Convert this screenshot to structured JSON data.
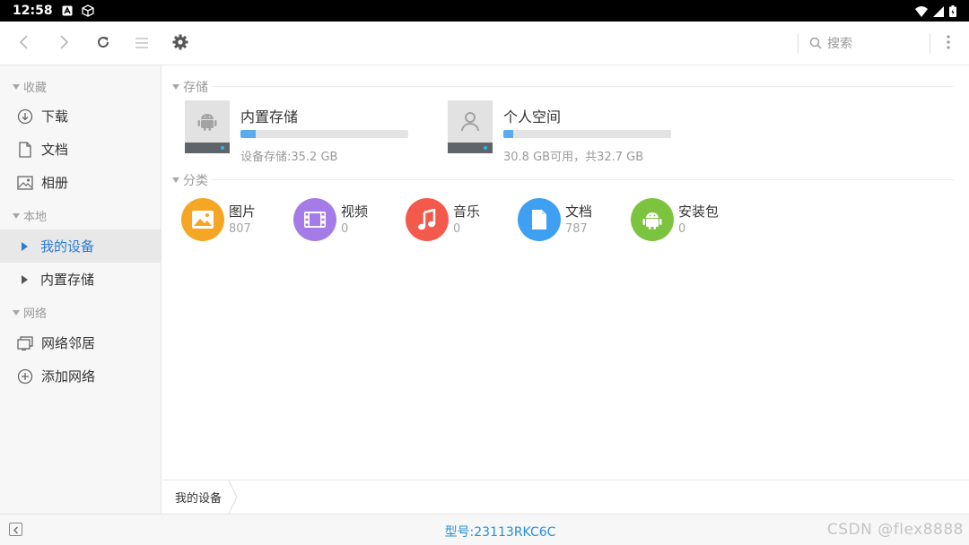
{
  "status_bar": {
    "time": "12:58"
  },
  "toolbar": {
    "search_placeholder": "搜索"
  },
  "sidebar": {
    "sections": [
      {
        "title": "收藏"
      },
      {
        "title": "本地"
      },
      {
        "title": "网络"
      }
    ],
    "items": [
      {
        "label": "下载"
      },
      {
        "label": "文档"
      },
      {
        "label": "相册"
      },
      {
        "label": "我的设备"
      },
      {
        "label": "内置存储"
      },
      {
        "label": "网络邻居"
      },
      {
        "label": "添加网络"
      }
    ]
  },
  "main": {
    "storage_header": "存储",
    "storage": [
      {
        "name": "内置存储",
        "info": "设备存储:35.2 GB",
        "used_fraction": 0.09
      },
      {
        "name": "个人空间",
        "info": "30.8 GB可用，共32.7 GB",
        "used_fraction": 0.06
      }
    ],
    "category_header": "分类",
    "categories": [
      {
        "name": "图片",
        "count": "807",
        "color": "#f5a623",
        "icon": "image-icon"
      },
      {
        "name": "视频",
        "count": "0",
        "color": "#a57be8",
        "icon": "film-icon"
      },
      {
        "name": "音乐",
        "count": "0",
        "color": "#f45a4c",
        "icon": "music-note-icon"
      },
      {
        "name": "文档",
        "count": "787",
        "color": "#3f9ff0",
        "icon": "document-icon"
      },
      {
        "name": "安装包",
        "count": "0",
        "color": "#7cc440",
        "icon": "android-icon"
      }
    ]
  },
  "breadcrumb": {
    "current": "我的设备"
  },
  "bottom_bar": {
    "model": "型号:23113RKC6C",
    "watermark": "CSDN @flex8888"
  },
  "colors": {
    "accent": "#2a7bd3",
    "model_text": "#2a8fd6",
    "progress": "#5aabf0"
  }
}
